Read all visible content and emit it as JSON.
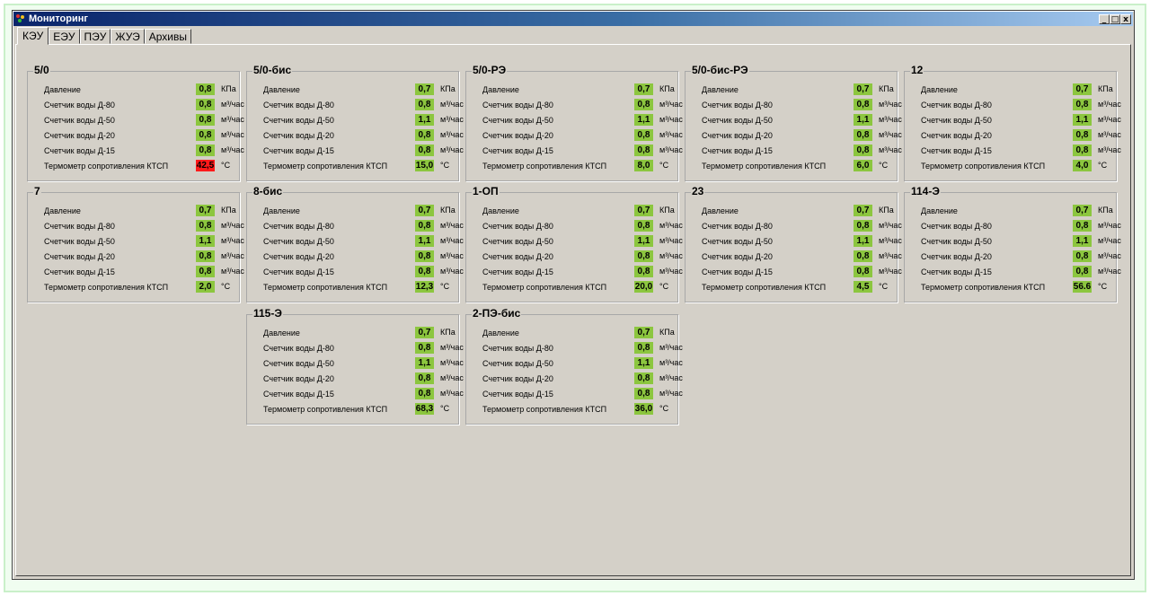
{
  "window": {
    "title": "Мониторинг",
    "buttons": {
      "minimize": "_",
      "maximize": "□",
      "close": "x"
    }
  },
  "tabs": [
    "КЭУ",
    "ЕЭУ",
    "ПЭУ",
    "ЖУЭ",
    "Архивы"
  ],
  "active_tab": "КЭУ",
  "labels": {
    "pressure": "Давление",
    "d80": "Счетчик воды Д-80",
    "d50": "Счетчик воды Д-50",
    "d20": "Счетчик воды Д-20",
    "d15": "Счетчик воды Д-15",
    "thermo": "Термометр сопротивления КТСП"
  },
  "units": {
    "pressure": "КПа",
    "flow": "м³/час",
    "temp": "°С"
  },
  "colors": {
    "normal": "#8cc63f",
    "alarm": "#ff1a1a"
  },
  "stations": [
    {
      "name": "5/0",
      "pressure": "0,8",
      "d80": "0,8",
      "d50": "0,8",
      "d20": "0,8",
      "d15": "0,8",
      "temp": "42,5",
      "temp_alarm": true
    },
    {
      "name": "5/0-бис",
      "pressure": "0,7",
      "d80": "0,8",
      "d50": "1,1",
      "d20": "0,8",
      "d15": "0,8",
      "temp": "15,0",
      "temp_alarm": false
    },
    {
      "name": "5/0-РЭ",
      "pressure": "0,7",
      "d80": "0,8",
      "d50": "1,1",
      "d20": "0,8",
      "d15": "0,8",
      "temp": "8,0",
      "temp_alarm": false
    },
    {
      "name": "5/0-бис-РЭ",
      "pressure": "0,7",
      "d80": "0,8",
      "d50": "1,1",
      "d20": "0,8",
      "d15": "0,8",
      "temp": "6,0",
      "temp_alarm": false
    },
    {
      "name": "12",
      "pressure": "0,7",
      "d80": "0,8",
      "d50": "1,1",
      "d20": "0,8",
      "d15": "0,8",
      "temp": "4,0",
      "temp_alarm": false
    },
    {
      "name": "7",
      "pressure": "0,7",
      "d80": "0,8",
      "d50": "1,1",
      "d20": "0,8",
      "d15": "0,8",
      "temp": "2,0",
      "temp_alarm": false
    },
    {
      "name": "8-бис",
      "pressure": "0,7",
      "d80": "0,8",
      "d50": "1,1",
      "d20": "0,8",
      "d15": "0,8",
      "temp": "12,3",
      "temp_alarm": false
    },
    {
      "name": "1-ОП",
      "pressure": "0,7",
      "d80": "0,8",
      "d50": "1,1",
      "d20": "0,8",
      "d15": "0,8",
      "temp": "20,0",
      "temp_alarm": false
    },
    {
      "name": "23",
      "pressure": "0,7",
      "d80": "0,8",
      "d50": "1,1",
      "d20": "0,8",
      "d15": "0,8",
      "temp": "4,5",
      "temp_alarm": false
    },
    {
      "name": "114-Э",
      "pressure": "0,7",
      "d80": "0,8",
      "d50": "1,1",
      "d20": "0,8",
      "d15": "0,8",
      "temp": "56.6",
      "temp_alarm": false
    },
    {
      "name": "115-Э",
      "pressure": "0,7",
      "d80": "0,8",
      "d50": "1,1",
      "d20": "0,8",
      "d15": "0,8",
      "temp": "68,3",
      "temp_alarm": false
    },
    {
      "name": "2-ПЭ-бис",
      "pressure": "0,7",
      "d80": "0,8",
      "d50": "1,1",
      "d20": "0,8",
      "d15": "0,8",
      "temp": "36,0",
      "temp_alarm": false
    }
  ]
}
